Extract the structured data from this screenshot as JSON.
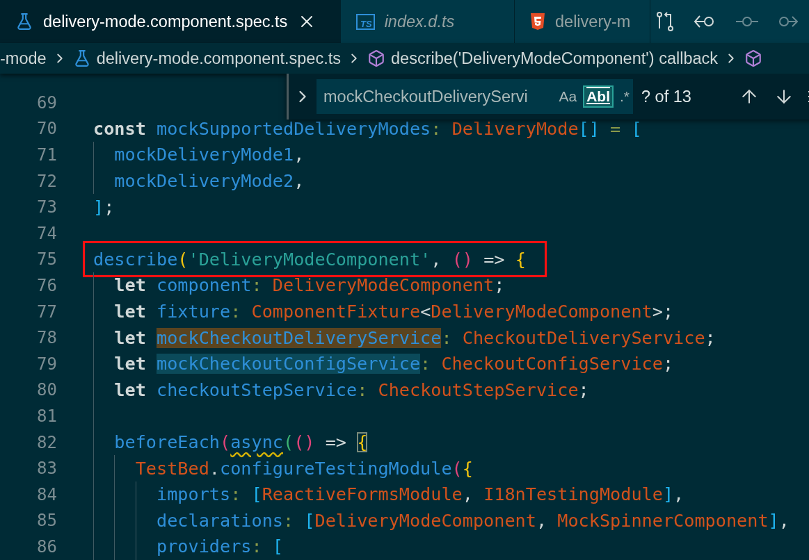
{
  "tabs": [
    {
      "label": "delivery-mode.component.spec.ts",
      "kind": "flask",
      "selected": true,
      "preview": false,
      "closable": true
    },
    {
      "label": "index.d.ts",
      "kind": "ts",
      "icon_text": "TS",
      "selected": false,
      "preview": true,
      "closable": false
    },
    {
      "label": "delivery-m",
      "kind": "html",
      "selected": false,
      "preview": false,
      "closable": false
    }
  ],
  "breadcrumbs": [
    {
      "label": "-mode"
    },
    {
      "label": "delivery-mode.component.spec.ts",
      "kind": "flask"
    },
    {
      "label": "describe('DeliveryModeComponent') callback",
      "kind": "symbol"
    },
    {
      "kind": "symbol"
    }
  ],
  "find_widget": {
    "value": "mockCheckoutDeliveryServi",
    "options": [
      {
        "label": "Aa",
        "kind": "case",
        "on": false
      },
      {
        "label": "Abl",
        "kind": "word",
        "on": true
      },
      {
        "label": ".*",
        "kind": "regex",
        "on": false
      }
    ],
    "count": "? of 13"
  },
  "lines": [
    {
      "n": "69"
    },
    {
      "n": "70",
      "tokens": [
        {
          "t": "const ",
          "kind": "kw"
        },
        {
          "t": "mockSupportedDeliveryModes",
          "kind": "v"
        },
        {
          "t": ": ",
          "kind": "op"
        },
        {
          "t": "DeliveryMode",
          "kind": "ty"
        },
        {
          "t": "[]",
          "kind": "bc"
        },
        {
          "t": " = ",
          "kind": "op"
        },
        {
          "t": "[",
          "kind": "bc"
        }
      ]
    },
    {
      "n": "71",
      "tokens": [
        {
          "t": "  mockDeliveryMode1",
          "kind": "v"
        },
        {
          "t": ",",
          "kind": "p"
        }
      ]
    },
    {
      "n": "72",
      "tokens": [
        {
          "t": "  mockDeliveryMode2",
          "kind": "v"
        },
        {
          "t": ",",
          "kind": "p"
        }
      ]
    },
    {
      "n": "73",
      "tokens": [
        {
          "t": "]",
          "kind": "bc"
        },
        {
          "t": ";",
          "kind": "p"
        }
      ]
    },
    {
      "n": "74"
    },
    {
      "n": "75",
      "boxed": true,
      "tokens": [
        {
          "t": "describe",
          "kind": "fn"
        },
        {
          "t": "(",
          "kind": "by"
        },
        {
          "t": "'DeliveryModeComponent'",
          "kind": "s"
        },
        {
          "t": ", ",
          "kind": "p"
        },
        {
          "t": "()",
          "kind": "bp"
        },
        {
          "t": " => ",
          "kind": "p"
        },
        {
          "t": "{",
          "kind": "by"
        }
      ]
    },
    {
      "n": "76",
      "tokens": [
        {
          "t": "  let ",
          "kind": "kw"
        },
        {
          "t": "component",
          "kind": "v"
        },
        {
          "t": ": ",
          "kind": "op"
        },
        {
          "t": "DeliveryModeComponent",
          "kind": "ty"
        },
        {
          "t": ";",
          "kind": "p"
        }
      ]
    },
    {
      "n": "77",
      "tokens": [
        {
          "t": "  let ",
          "kind": "kw"
        },
        {
          "t": "fixture",
          "kind": "v"
        },
        {
          "t": ": ",
          "kind": "op"
        },
        {
          "t": "ComponentFixture",
          "kind": "ty"
        },
        {
          "t": "<",
          "kind": "p"
        },
        {
          "t": "DeliveryModeComponent",
          "kind": "ty"
        },
        {
          "t": ">;",
          "kind": "p"
        }
      ]
    },
    {
      "n": "78",
      "tokens": [
        {
          "t": "  let ",
          "kind": "kw"
        },
        {
          "t": "mockCheckoutDeliveryService",
          "kind": "v",
          "current_match": true
        },
        {
          "t": ": ",
          "kind": "op"
        },
        {
          "t": "CheckoutDeliveryService",
          "kind": "ty"
        },
        {
          "t": ";",
          "kind": "p"
        }
      ]
    },
    {
      "n": "79",
      "tokens": [
        {
          "t": "  let ",
          "kind": "kw"
        },
        {
          "t": "mockCheckoutConfigService",
          "kind": "v",
          "other_match": true
        },
        {
          "t": ": ",
          "kind": "op"
        },
        {
          "t": "CheckoutConfigService",
          "kind": "ty"
        },
        {
          "t": ";",
          "kind": "p"
        }
      ]
    },
    {
      "n": "80",
      "tokens": [
        {
          "t": "  let ",
          "kind": "kw"
        },
        {
          "t": "checkoutStepService",
          "kind": "v"
        },
        {
          "t": ": ",
          "kind": "op"
        },
        {
          "t": "CheckoutStepService",
          "kind": "ty"
        },
        {
          "t": ";",
          "kind": "p"
        }
      ]
    },
    {
      "n": "81"
    },
    {
      "n": "82",
      "tokens": [
        {
          "t": "  beforeEach",
          "kind": "fn"
        },
        {
          "t": "(",
          "kind": "bp"
        },
        {
          "t": "async",
          "kind": "v",
          "warning": true
        },
        {
          "t": "(",
          "kind": "bg"
        },
        {
          "t": "()",
          "kind": "bp"
        },
        {
          "t": " => ",
          "kind": "p"
        },
        {
          "t": "{",
          "kind": "by",
          "bracket_match": true
        }
      ]
    },
    {
      "n": "83",
      "tokens": [
        {
          "t": "    TestBed",
          "kind": "ty"
        },
        {
          "t": ".",
          "kind": "p"
        },
        {
          "t": "configureTestingModule",
          "kind": "fn"
        },
        {
          "t": "(",
          "kind": "bp"
        },
        {
          "t": "{",
          "kind": "by"
        }
      ]
    },
    {
      "n": "84",
      "tokens": [
        {
          "t": "      imports",
          "kind": "v"
        },
        {
          "t": ": ",
          "kind": "op"
        },
        {
          "t": "[",
          "kind": "bc"
        },
        {
          "t": "ReactiveFormsModule",
          "kind": "ty"
        },
        {
          "t": ", ",
          "kind": "p"
        },
        {
          "t": "I18nTestingModule",
          "kind": "ty"
        },
        {
          "t": "]",
          "kind": "bc"
        },
        {
          "t": ",",
          "kind": "p"
        }
      ]
    },
    {
      "n": "85",
      "tokens": [
        {
          "t": "      declarations",
          "kind": "v"
        },
        {
          "t": ": ",
          "kind": "op"
        },
        {
          "t": "[",
          "kind": "bc"
        },
        {
          "t": "DeliveryModeComponent",
          "kind": "ty"
        },
        {
          "t": ", ",
          "kind": "p"
        },
        {
          "t": "MockSpinnerComponent",
          "kind": "ty"
        },
        {
          "t": "]",
          "kind": "bc"
        },
        {
          "t": ",",
          "kind": "p"
        }
      ]
    },
    {
      "n": "86",
      "tokens": [
        {
          "t": "      providers",
          "kind": "v"
        },
        {
          "t": ": ",
          "kind": "op"
        },
        {
          "t": "[",
          "kind": "bc"
        }
      ]
    }
  ]
}
